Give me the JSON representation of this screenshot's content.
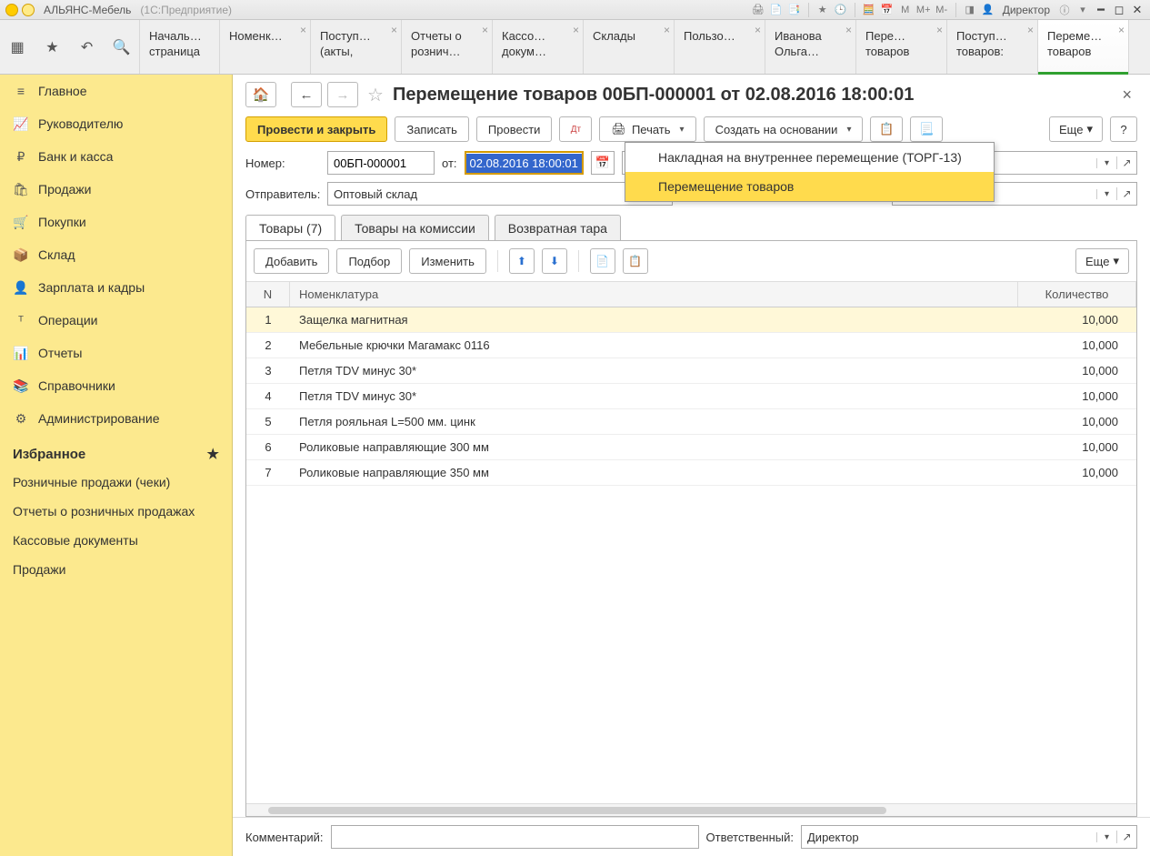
{
  "titlebar": {
    "app_title": "АЛЬЯНС-Мебель",
    "app_sub": "(1С:Предприятие)",
    "m_label": "M",
    "mplus_label": "M+",
    "mminus_label": "M-",
    "user": "Директор"
  },
  "tabs": {
    "home": "Началь…\nстраница",
    "items": [
      {
        "label": "Номенк…"
      },
      {
        "label": "Поступ… (акты,"
      },
      {
        "label": "Отчеты о рознич…"
      },
      {
        "label": "Кассо… докум…"
      },
      {
        "label": "Склады"
      },
      {
        "label": "Пользо…"
      },
      {
        "label": "Иванова Ольга…"
      },
      {
        "label": "Пере… товаров"
      },
      {
        "label": "Поступ… товаров:"
      },
      {
        "label": "Переме… товаров"
      }
    ]
  },
  "sidebar": {
    "items": [
      {
        "icon": "≡",
        "label": "Главное"
      },
      {
        "icon": "📈",
        "label": "Руководителю"
      },
      {
        "icon": "₽",
        "label": "Банк и касса"
      },
      {
        "icon": "🛍",
        "label": "Продажи"
      },
      {
        "icon": "🛒",
        "label": "Покупки"
      },
      {
        "icon": "📦",
        "label": "Склад"
      },
      {
        "icon": "👤",
        "label": "Зарплата и кадры"
      },
      {
        "icon": "ᵀ",
        "label": "Операции"
      },
      {
        "icon": "📊",
        "label": "Отчеты"
      },
      {
        "icon": "📚",
        "label": "Справочники"
      },
      {
        "icon": "⚙",
        "label": "Администрирование"
      }
    ],
    "fav_header": "Избранное",
    "fav_links": [
      "Розничные продажи (чеки)",
      "Отчеты о розничных продажах",
      "Кассовые документы",
      "Продажи"
    ]
  },
  "doc": {
    "title": "Перемещение товаров 00БП-000001 от 02.08.2016 18:00:01"
  },
  "toolbar": {
    "post_close": "Провести и закрыть",
    "save": "Записать",
    "post": "Провести",
    "print": "Печать",
    "base": "Создать на основании",
    "more": "Еще",
    "help": "?"
  },
  "print_menu": {
    "item1": "Накладная на внутреннее перемещение (ТОРГ-13)",
    "item2": "Перемещение товаров"
  },
  "form": {
    "number_label": "Номер:",
    "number_value": "00БП-000001",
    "from_label": "от:",
    "date_value": "02.08.2016 18:00:01",
    "sender_label": "Отправитель:",
    "sender_value": "Оптовый склад"
  },
  "subtabs": {
    "t1": "Товары (7)",
    "t2": "Товары на комиссии",
    "t3": "Возвратная тара"
  },
  "table_toolbar": {
    "add": "Добавить",
    "pick": "Подбор",
    "edit": "Изменить",
    "more": "Еще"
  },
  "grid": {
    "headers": {
      "n": "N",
      "name": "Номенклатура",
      "qty": "Количество"
    },
    "rows": [
      {
        "n": "1",
        "name": "Защелка магнитная",
        "qty": "10,000"
      },
      {
        "n": "2",
        "name": "Мебельные крючки Магамакс 0116",
        "qty": "10,000"
      },
      {
        "n": "3",
        "name": "Петля TDV минус 30*",
        "qty": "10,000"
      },
      {
        "n": "4",
        "name": "Петля TDV минус 30*",
        "qty": "10,000"
      },
      {
        "n": "5",
        "name": "Петля рояльная L=500 мм. цинк",
        "qty": "10,000"
      },
      {
        "n": "6",
        "name": "Роликовые направляющие 300 мм",
        "qty": "10,000"
      },
      {
        "n": "7",
        "name": "Роликовые направляющие 350 мм",
        "qty": "10,000"
      }
    ]
  },
  "bottom": {
    "comment_label": "Комментарий:",
    "resp_label": "Ответственный:",
    "resp_value": "Директор"
  }
}
